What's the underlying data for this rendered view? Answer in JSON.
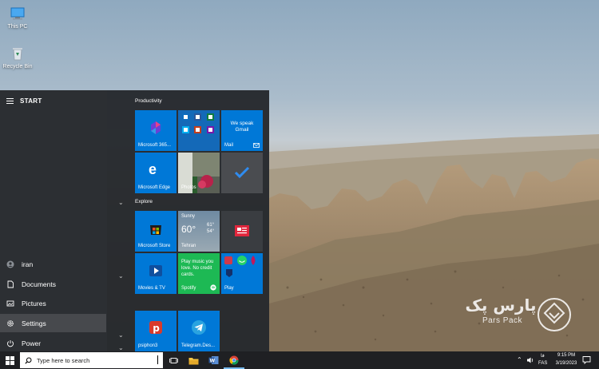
{
  "desktop": {
    "icons": [
      {
        "label": "This PC",
        "icon": "computer-icon"
      },
      {
        "label": "Recycle Bin",
        "icon": "recycle-bin-icon"
      }
    ]
  },
  "watermark": {
    "persian": "پارس پک",
    "english": "Pars Pack"
  },
  "start_menu": {
    "title": "START",
    "left_nav": [
      {
        "label": "iran",
        "icon": "user-avatar-icon"
      },
      {
        "label": "Documents",
        "icon": "document-icon"
      },
      {
        "label": "Pictures",
        "icon": "picture-icon"
      },
      {
        "label": "Settings",
        "icon": "gear-icon"
      },
      {
        "label": "Power",
        "icon": "power-icon"
      }
    ],
    "groups": [
      {
        "title": "Productivity"
      },
      {
        "title": "Explore"
      }
    ],
    "tiles": {
      "microsoft365": "Microsoft 365...",
      "mail_line1": "We speak",
      "mail_line2": "Gmail",
      "mail_label": "Mail",
      "edge": "Microsoft Edge",
      "photos": "Photos",
      "store": "Microsoft Store",
      "weather_cond": "Sunny",
      "weather_temp": "60°",
      "weather_hi": "61°",
      "weather_lo": "54°",
      "weather_city": "Tehran",
      "movies": "Movies & TV",
      "spotify_text": "Play music you love. No credit cards.",
      "spotify_label": "Spotify",
      "play": "Play",
      "psiphon": "psiphon3",
      "telegram": "Telegram.Des..."
    }
  },
  "taskbar": {
    "search_placeholder": "Type here to search",
    "tray": {
      "lang_fa": "فا",
      "lang": "FAS",
      "time": "9:15 PM",
      "date": "3/19/2023"
    }
  }
}
